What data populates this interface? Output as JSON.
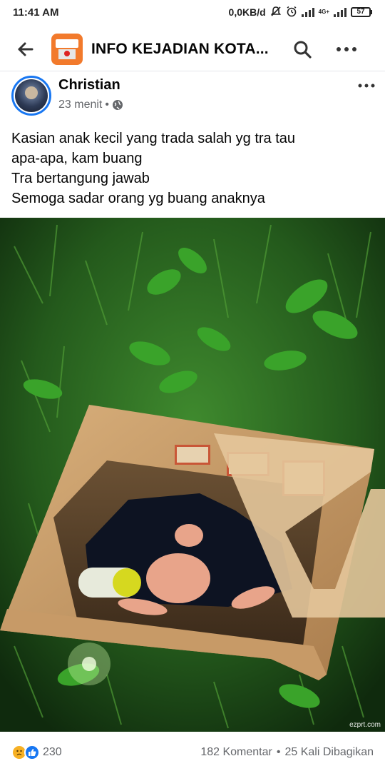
{
  "status_bar": {
    "time": "11:41 AM",
    "data_rate": "0,0KB/d",
    "network_label": "4G+",
    "battery": "57"
  },
  "app_bar": {
    "title": "INFO KEJADIAN KOTA..."
  },
  "post": {
    "author": "Christian",
    "time_ago": "23 menit",
    "separator": "•",
    "text_lines": [
      "Kasian anak kecil yang trada salah yg tra tau",
      "apa-apa, kam buang",
      "Tra bertangung jawab",
      "Semoga sadar orang yg buang anaknya"
    ],
    "image_watermark": "ezprt.com"
  },
  "footer": {
    "reaction_count": "230",
    "comments": "182 Komentar",
    "separator": "•",
    "shares": "25 Kali Dibagikan"
  },
  "icons": {
    "back": "arrow-left-icon",
    "search": "search-icon",
    "more": "more-horizontal-icon",
    "privacy": "globe-icon",
    "reaction_sad": "sad-reaction-icon",
    "reaction_like": "like-reaction-icon"
  },
  "colors": {
    "accent": "#1877f2",
    "group_avatar": "#f27a2c",
    "secondary_text": "#65676b"
  }
}
